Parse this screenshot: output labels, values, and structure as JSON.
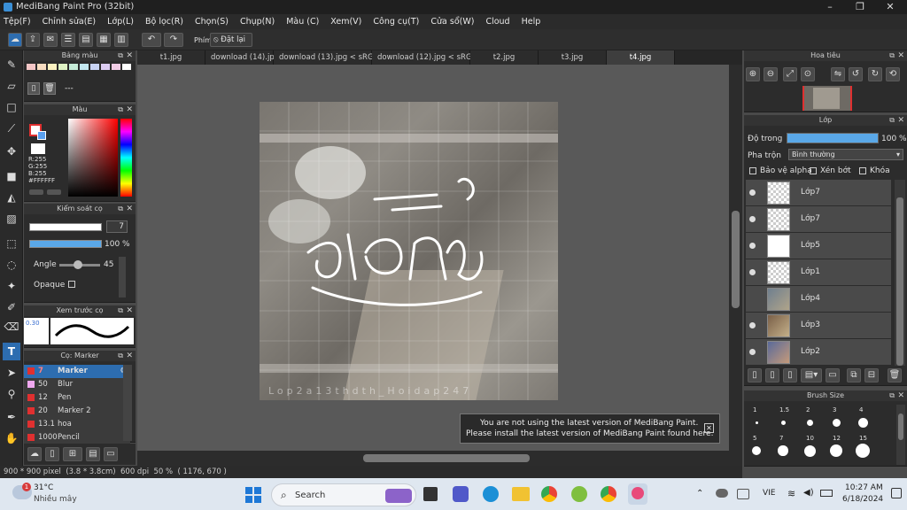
{
  "window": {
    "title": "MediBang Paint Pro (32bit)",
    "minimize": "–",
    "maximize": "❐",
    "close": "✕"
  },
  "menu": [
    "Tệp(F)",
    "Chỉnh sửa(E)",
    "Lớp(L)",
    "Bộ lọc(R)",
    "Chọn(S)",
    "Chụp(N)",
    "Màu (C)",
    "Xem(V)",
    "Công cụ(T)",
    "Cửa sổ(W)",
    "Cloud",
    "Help"
  ],
  "toolbar": {
    "phim_label": "Phím",
    "reset_label": "Đặt lại"
  },
  "tabs": [
    "t1.jpg",
    "download (14).jpg",
    "download (13).jpg < sRGB >",
    "download (12).jpg < sRGB >",
    "t2.jpg",
    "t3.jpg",
    "t4.jpg"
  ],
  "panels": {
    "palette": {
      "title": "Bảng màu",
      "swatches": [
        "#f4c6c6",
        "#f7dcc0",
        "#fbf1c0",
        "#dff2c4",
        "#c6ecd8",
        "#c4e8f1",
        "#c8d4f4",
        "#dcccf2",
        "#f2cde6",
        "#ffffff"
      ],
      "dashes": "---"
    },
    "color": {
      "title": "Màu",
      "r": "R:255",
      "g": "G:255",
      "b": "B:255",
      "hex": "#FFFFFF"
    },
    "brushctl": {
      "title": "Kiểm soát cọ",
      "size": "7",
      "opacity": "100 %",
      "angle_label": "Angle",
      "angle_value": "45",
      "opaque_label": "Opaque"
    },
    "preview": {
      "title": "Xem trước cọ",
      "size": "0.30"
    },
    "brushes": {
      "title": "Cọ: Marker",
      "items": [
        {
          "size": "7",
          "name": "Marker",
          "color": "#e03030"
        },
        {
          "size": "50",
          "name": "Blur",
          "color": "#f0a8f0"
        },
        {
          "size": "12",
          "name": "Pen",
          "color": "#e03030"
        },
        {
          "size": "20",
          "name": "Marker 2",
          "color": "#e03030"
        },
        {
          "size": "13.1",
          "name": "hoa",
          "color": "#e03030"
        },
        {
          "size": "1000",
          "name": "Pencil",
          "color": "#e03030"
        }
      ]
    }
  },
  "navigator": {
    "title": "Hoa tiêu"
  },
  "layers": {
    "title": "Lớp",
    "opacity_label": "Độ trong",
    "opacity_value": "100 %",
    "opacity_fill": 1.0,
    "blend_label": "Pha trộn",
    "blend_value": "Bình thường",
    "protect_alpha": "Bảo vệ alpha",
    "clip": "Xén bớt",
    "lock": "Khóa",
    "items": [
      {
        "name": "Lớp7",
        "thumb": "transparent"
      },
      {
        "name": "Lớp7",
        "thumb": "transparent"
      },
      {
        "name": "Lớp5",
        "thumb": "white"
      },
      {
        "name": "Lớp1",
        "thumb": "transparent"
      },
      {
        "name": "Lớp4",
        "thumb": "image1"
      },
      {
        "name": "Lớp3",
        "thumb": "image2"
      },
      {
        "name": "Lớp2",
        "thumb": "image3"
      }
    ]
  },
  "brushsize": {
    "title": "Brush Size",
    "row1": [
      "1",
      "1.5",
      "2",
      "3",
      "4"
    ],
    "row2": [
      "5",
      "7",
      "10",
      "12",
      "15"
    ]
  },
  "canvas": {
    "watermark": "Lop2a13thdth_Hoidap247"
  },
  "notification": {
    "line1": "You are not using the latest version of MediBang Paint.",
    "line2": "Please install the latest version of MediBang Paint found here."
  },
  "status": "900 * 900 pixel  (3.8 * 3.8cm)  600 dpi  50 %  ( 1176, 670 )",
  "taskbar": {
    "temp": "31°C",
    "weather": "Nhiều mây",
    "badge": "1",
    "search": "Search",
    "lang": "VIE",
    "time": "10:27 AM",
    "date": "6/18/2024"
  }
}
